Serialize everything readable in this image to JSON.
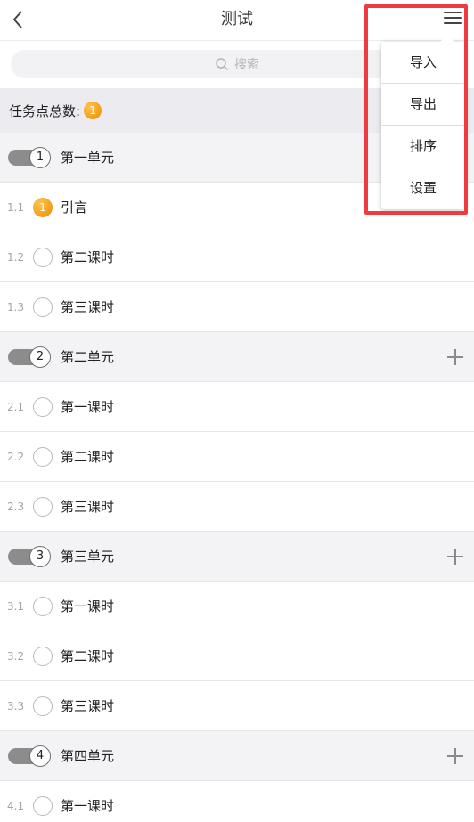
{
  "header": {
    "title": "测试"
  },
  "search": {
    "placeholder": "搜索"
  },
  "summary": {
    "label": "任务点总数:",
    "count": "1"
  },
  "dropdown": {
    "items": [
      "导入",
      "导出",
      "排序",
      "设置"
    ]
  },
  "units": [
    {
      "index": "1",
      "title": "第一单元",
      "lessons": [
        {
          "num": "1.1",
          "title": "引言",
          "done": true,
          "badge": "1"
        },
        {
          "num": "1.2",
          "title": "第二课时",
          "done": false
        },
        {
          "num": "1.3",
          "title": "第三课时",
          "done": false
        }
      ]
    },
    {
      "index": "2",
      "title": "第二单元",
      "lessons": [
        {
          "num": "2.1",
          "title": "第一课时",
          "done": false
        },
        {
          "num": "2.2",
          "title": "第二课时",
          "done": false
        },
        {
          "num": "2.3",
          "title": "第三课时",
          "done": false
        }
      ]
    },
    {
      "index": "3",
      "title": "第三单元",
      "lessons": [
        {
          "num": "3.1",
          "title": "第一课时",
          "done": false
        },
        {
          "num": "3.2",
          "title": "第二课时",
          "done": false
        },
        {
          "num": "3.3",
          "title": "第三课时",
          "done": false
        }
      ]
    },
    {
      "index": "4",
      "title": "第四单元",
      "lessons": [
        {
          "num": "4.1",
          "title": "第一课时",
          "done": false
        }
      ]
    }
  ],
  "colors": {
    "accent": "#f08a00",
    "highlight_box": "#ef3b3f",
    "toggle": "#8c8c8c"
  }
}
